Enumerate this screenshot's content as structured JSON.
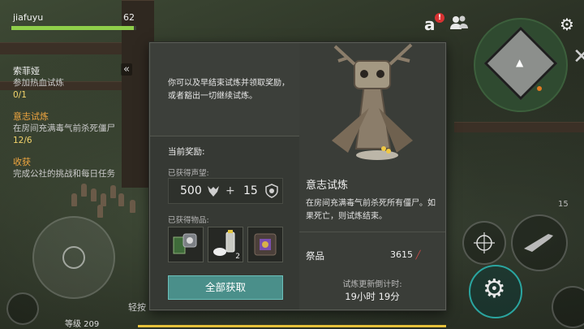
{
  "player": {
    "name": "jiafuyu",
    "level": "62",
    "hp_fraction": 0.98
  },
  "quests": [
    {
      "title": "索菲娅",
      "desc": "参加热血试炼",
      "progress": "0/1",
      "title_color": "#f2f2f2"
    },
    {
      "title": "意志试炼",
      "desc": "在房间充满毒气前杀死僵尸",
      "progress": "12/6",
      "title_color": "#f0a640"
    },
    {
      "title": "收获",
      "desc": "完成公社的挑战和每日任务",
      "progress": "",
      "title_color": "#f0a640"
    }
  ],
  "hud": {
    "letter_icon": "a",
    "alert": "!",
    "ammo": "15",
    "xp_label": "等级 209",
    "chat_hint": "轻按"
  },
  "dialog": {
    "intro": "你可以及早结束试炼并领取奖励，或者豁出一切继续试炼。",
    "rewards_title": "当前奖励:",
    "reputation_label": "已获得声望:",
    "reputation_a": "500",
    "plus": "+",
    "reputation_b": "15",
    "items_label": "已获得物品:",
    "items": [
      {
        "icon": "blueprint-items-icon",
        "count": ""
      },
      {
        "icon": "spray-can-bandage-icon",
        "count": "2"
      },
      {
        "icon": "purple-crate-icon",
        "count": ""
      }
    ],
    "claim_label": "全部获取",
    "trial_title": "意志试炼",
    "trial_desc": "在房间充满毒气前杀死所有僵尸。如果死亡，则试炼结束。",
    "sacrifice_label": "祭品",
    "sacrifice_value": "3615",
    "timer_label": "试炼更新倒计时:",
    "timer_value": "19小时 19分"
  },
  "colors": {
    "accent": "#4a8f8a",
    "hp": "#8fcf4a",
    "quest_active": "#f0a640",
    "progress": "#f2d36a"
  }
}
